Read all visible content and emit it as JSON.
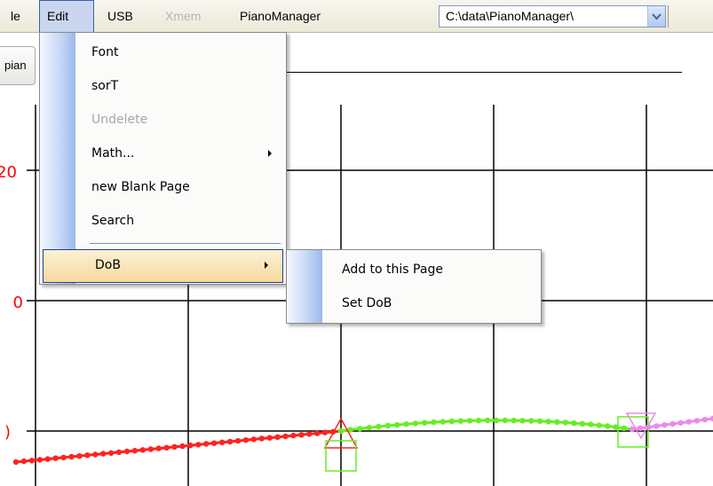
{
  "menubar": {
    "items": [
      {
        "label": "le"
      },
      {
        "label": "Edit"
      },
      {
        "label": "USB"
      },
      {
        "label": "Xmem"
      },
      {
        "label": "PianoManager"
      }
    ],
    "path": "C:\\data\\PianoManager\\"
  },
  "toolbar": {
    "tab_label": "pian"
  },
  "edit_menu": {
    "items": [
      {
        "label": "Font"
      },
      {
        "label": "sorT"
      },
      {
        "label": "Undelete"
      },
      {
        "label": "Math..."
      },
      {
        "label": "new Blank Page"
      },
      {
        "label": "Search"
      },
      {
        "label": "DoB"
      }
    ]
  },
  "dob_submenu": {
    "items": [
      {
        "label": "Add to this Page"
      },
      {
        "label": "Set DoB"
      }
    ]
  },
  "chart_data": {
    "type": "line",
    "y_tick_labels": [
      "20",
      "0",
      ")"
    ],
    "colors": {
      "grid": "#000000",
      "tick_labels": "#ff0000",
      "segment1": "#ff2222",
      "segment2": "#66ee22",
      "segment3": "#ee88ee"
    }
  }
}
